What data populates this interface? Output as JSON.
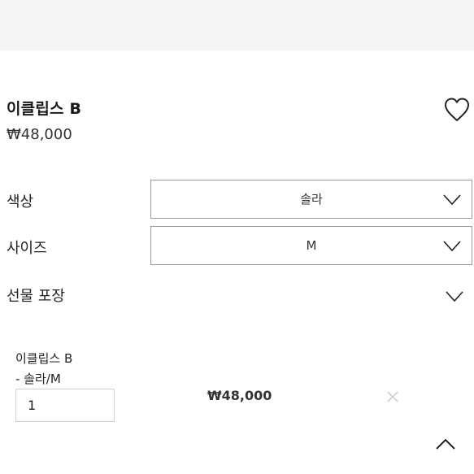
{
  "product": {
    "name": "이클립스 B",
    "price": "₩48,000"
  },
  "options": {
    "color": {
      "label": "색상",
      "selected": "솔라"
    },
    "size": {
      "label": "사이즈",
      "selected": "M"
    },
    "gift": {
      "label": "선물 포장"
    }
  },
  "selection": {
    "name": "이클립스 B",
    "option": "- 솔라/M",
    "quantity": "1",
    "price": "₩48,000"
  },
  "icons": {
    "wishlist": "heart-icon",
    "dropdown": "chevron-down-icon",
    "remove": "close-icon",
    "scroll_top": "chevron-up-icon"
  },
  "colors": {
    "header_bg": "#f5f5f5",
    "border": "#9a9a9a",
    "remove_icon": "#c8c8c8"
  }
}
